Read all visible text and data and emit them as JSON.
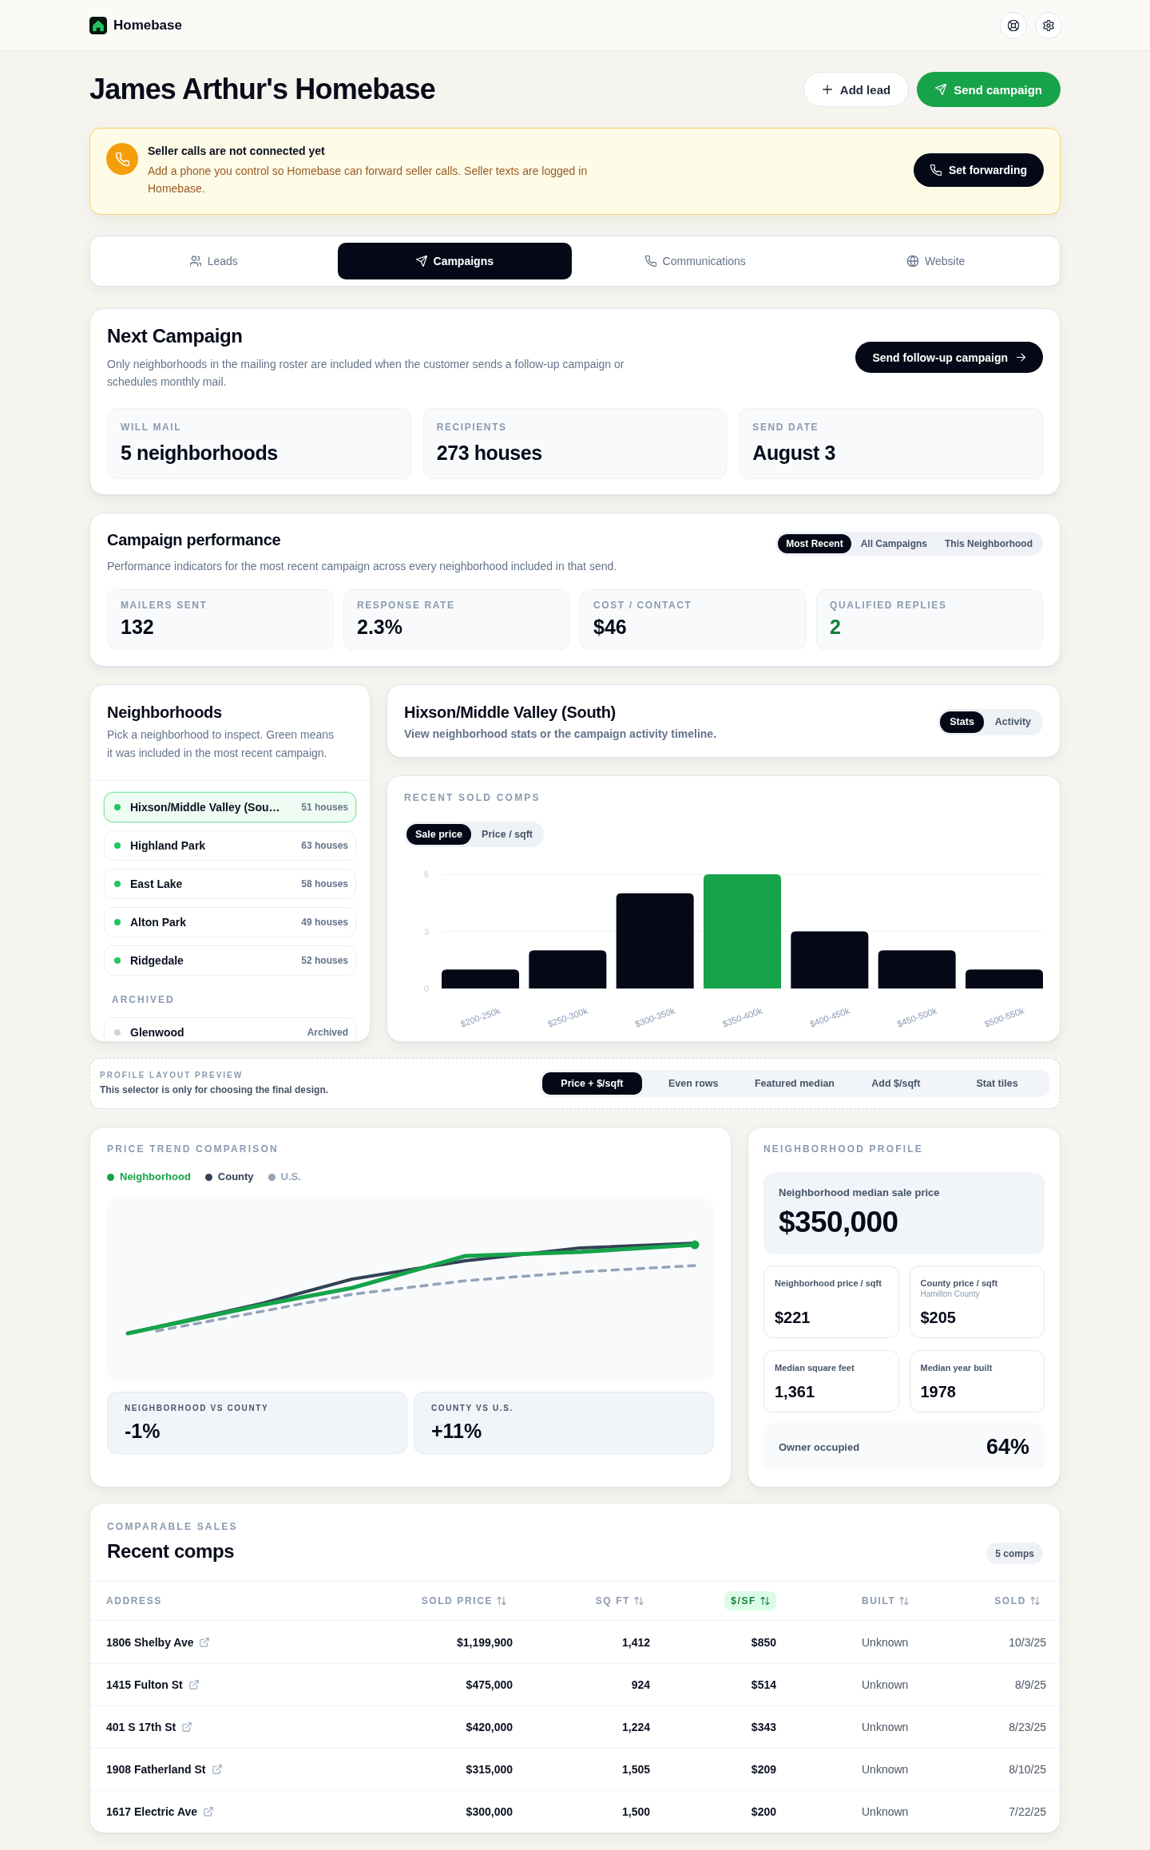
{
  "top_bar": {
    "brand": "Homebase"
  },
  "header": {
    "title": "James Arthur's Homebase",
    "actions": [
      {
        "label": "Add lead",
        "kind": "secondary"
      },
      {
        "label": "Send campaign",
        "kind": "primary"
      }
    ]
  },
  "alert": {
    "title": "Seller calls are not connected yet",
    "message": "Add a phone you control so Homebase can forward seller calls. Seller texts are logged in Homebase.",
    "action": "Set forwarding"
  },
  "tabs": [
    {
      "label": "Leads",
      "selected": false
    },
    {
      "label": "Campaigns",
      "selected": true
    },
    {
      "label": "Communications",
      "selected": false
    },
    {
      "label": "Website",
      "selected": false
    }
  ],
  "next_campaign": {
    "title": "Next Campaign",
    "description": "Only neighborhoods in the mailing roster are included when the customer sends a follow-up campaign or schedules monthly mail.",
    "action": "Send follow-up campaign",
    "stats": [
      {
        "label": "WILL MAIL",
        "value": "5 neighborhoods"
      },
      {
        "label": "RECIPIENTS",
        "value": "273 houses"
      },
      {
        "label": "SEND DATE",
        "value": "August 3"
      }
    ]
  },
  "campaign_performance": {
    "title": "Campaign performance",
    "filters": [
      {
        "label": "Most Recent",
        "selected": true
      },
      {
        "label": "All Campaigns",
        "selected": false
      },
      {
        "label": "This Neighborhood",
        "selected": false
      }
    ],
    "description": "Performance indicators for the most recent campaign across every neighborhood included in that send.",
    "metrics": [
      {
        "label": "MAILERS SENT",
        "value": "132",
        "highlight": false
      },
      {
        "label": "RESPONSE RATE",
        "value": "2.3%",
        "highlight": false
      },
      {
        "label": "COST / CONTACT",
        "value": "$46",
        "highlight": false
      },
      {
        "label": "QUALIFIED REPLIES",
        "value": "2",
        "highlight": true
      }
    ]
  },
  "neighborhoods": {
    "title": "Neighborhoods",
    "description": "Pick a neighborhood to inspect. Green means it was included in the most recent campaign.",
    "items": [
      {
        "name": "Hixson/Middle Valley (Sou…",
        "note": "51 houses",
        "color": "#22c55e",
        "selected": true
      },
      {
        "name": "Highland Park",
        "note": "63 houses",
        "color": "#22c55e",
        "selected": false
      },
      {
        "name": "East Lake",
        "note": "58 houses",
        "color": "#22c55e",
        "selected": false
      },
      {
        "name": "Alton Park",
        "note": "49 houses",
        "color": "#22c55e",
        "selected": false
      },
      {
        "name": "Ridgedale",
        "note": "52 houses",
        "color": "#22c55e",
        "selected": false
      }
    ],
    "archived_label": "ARCHIVED",
    "archived_items": [
      {
        "name": "Glenwood",
        "note": "Archived",
        "color": "#cbd5e1",
        "selected": false
      }
    ]
  },
  "neighborhood_detail": {
    "title": "Hixson/Middle Valley (South)",
    "description": "View neighborhood stats or the campaign activity timeline.",
    "views": [
      {
        "label": "Stats",
        "selected": true
      },
      {
        "label": "Activity",
        "selected": false
      }
    ]
  },
  "sold_comps": {
    "label": "RECENT SOLD COMPS",
    "metrics": [
      {
        "label": "Sale price",
        "selected": true
      },
      {
        "label": "Price / sqft",
        "selected": false
      }
    ],
    "highlighted_bars": [
      false,
      false,
      false,
      true,
      false,
      false,
      false
    ],
    "chart_data": {
      "type": "bar",
      "categories": [
        "$200-250k",
        "$250-300k",
        "$300-350k",
        "$350-400k",
        "$400-450k",
        "$450-500k",
        "$500-550k"
      ],
      "values": [
        1,
        2,
        5,
        6,
        3,
        2,
        1
      ],
      "ylim": [
        0,
        6
      ],
      "yticks": [
        0,
        3,
        6
      ]
    }
  },
  "layout_preview": {
    "label": "PROFILE LAYOUT PREVIEW",
    "note": "This selector is only for choosing the final design.",
    "options": [
      {
        "label": "Price + $/sqft",
        "selected": true
      },
      {
        "label": "Even rows",
        "selected": false
      },
      {
        "label": "Featured median",
        "selected": false
      },
      {
        "label": "Add $/sqft",
        "selected": false
      },
      {
        "label": "Stat tiles",
        "selected": false
      }
    ]
  },
  "price_trend": {
    "label": "PRICE TREND COMPARISON",
    "legend": [
      {
        "name": "Neighborhood",
        "color": "#16a34a",
        "kind": "solid"
      },
      {
        "name": "County",
        "color": "#334155",
        "kind": "solid"
      },
      {
        "name": "U.S.",
        "color": "#94a3b8",
        "kind": "dashed"
      }
    ],
    "comparisons": [
      {
        "label": "NEIGHBORHOOD VS COUNTY",
        "value": "-1%"
      },
      {
        "label": "COUNTY VS U.S.",
        "value": "+11%"
      }
    ]
  },
  "neighborhood_profile": {
    "label": "NEIGHBORHOOD PROFILE",
    "featured": {
      "label": "Neighborhood median sale price",
      "value": "$350,000"
    },
    "tiles": [
      {
        "label": "Neighborhood price / sqft",
        "value": "$221"
      },
      {
        "label": "County price / sqft",
        "sublabel": "Hamilton County",
        "value": "$205"
      },
      {
        "label": "Median square feet",
        "value": "1,361"
      },
      {
        "label": "Median year built",
        "value": "1978"
      }
    ],
    "owner_occupied": {
      "label": "Owner occupied",
      "value": "64%"
    }
  },
  "recent_comps": {
    "label": "COMPARABLE SALES",
    "title": "Recent comps",
    "count": "5 comps",
    "columns": [
      {
        "label": "ADDRESS",
        "kind": "link",
        "sortable": false,
        "sorted": false
      },
      {
        "label": "SOLD PRICE",
        "kind": "number",
        "sortable": true,
        "sorted": false
      },
      {
        "label": "SQ FT",
        "kind": "number",
        "sortable": true,
        "sorted": false
      },
      {
        "label": "$/SF",
        "kind": "number",
        "sortable": true,
        "sorted": true
      },
      {
        "label": "BUILT",
        "kind": "text",
        "sortable": true,
        "sorted": false
      },
      {
        "label": "SOLD",
        "kind": "date",
        "sortable": true,
        "sorted": false
      }
    ],
    "rows": [
      [
        "1806 Shelby Ave",
        "$1,199,900",
        "1,412",
        "$850",
        "Unknown",
        "10/3/25"
      ],
      [
        "1415 Fulton St",
        "$475,000",
        "924",
        "$514",
        "Unknown",
        "8/9/25"
      ],
      [
        "401 S 17th St",
        "$420,000",
        "1,224",
        "$343",
        "Unknown",
        "8/23/25"
      ],
      [
        "1908 Fatherland St",
        "$315,000",
        "1,505",
        "$209",
        "Unknown",
        "8/10/25"
      ],
      [
        "1617 Electric Ave",
        "$300,000",
        "1,500",
        "$200",
        "Unknown",
        "7/22/25"
      ]
    ]
  }
}
